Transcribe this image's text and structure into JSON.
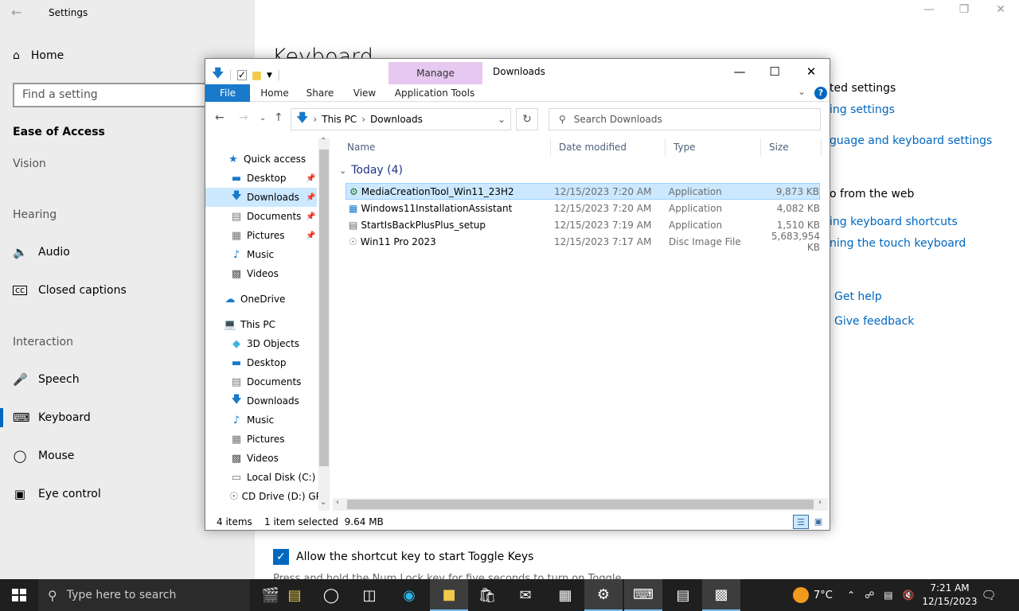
{
  "settings": {
    "title": "Settings",
    "home": "Home",
    "search_placeholder": "Find a setting",
    "category": "Ease of Access",
    "groups": {
      "vision": "Vision",
      "hearing": "Hearing",
      "interaction": "Interaction"
    },
    "items": {
      "audio": "Audio",
      "closed_captions": "Closed captions",
      "speech": "Speech",
      "keyboard": "Keyboard",
      "mouse": "Mouse",
      "eye_control": "Eye control"
    },
    "heading": "Keyboard",
    "right_panel": {
      "related_title": "ted settings",
      "link1": "ing settings",
      "link2": "guage and keyboard settings",
      "web_title": "o from the web",
      "link3": "ing keyboard shortcuts",
      "link4": "ning the touch keyboard",
      "get_help": "Get help",
      "give_feedback": "Give feedback"
    },
    "toggle_checkbox_label": "Allow the shortcut key to start Toggle Keys",
    "toggle_desc": "Press and hold the Num Lock key for five seconds to turn on Toggle"
  },
  "explorer": {
    "window_title": "Downloads",
    "manage_tab": "Manage",
    "ribbon_tabs": [
      "File",
      "Home",
      "Share",
      "View",
      "Application Tools"
    ],
    "address": {
      "segments": [
        "This PC",
        "Downloads"
      ]
    },
    "search_placeholder": "Search Downloads",
    "nav": {
      "quick_access": "Quick access",
      "desktop": "Desktop",
      "downloads": "Downloads",
      "documents": "Documents",
      "pictures": "Pictures",
      "music": "Music",
      "videos": "Videos",
      "onedrive": "OneDrive",
      "this_pc": "This PC",
      "objects3d": "3D Objects",
      "pc_desktop": "Desktop",
      "pc_documents": "Documents",
      "pc_downloads": "Downloads",
      "pc_music": "Music",
      "pc_pictures": "Pictures",
      "pc_videos": "Videos",
      "local_disk": "Local Disk (C:)",
      "cd_drive": "CD Drive (D:) GP"
    },
    "columns": {
      "name": "Name",
      "date": "Date modified",
      "type": "Type",
      "size": "Size"
    },
    "group_label": "Today (4)",
    "files": [
      {
        "name": "MediaCreationTool_Win11_23H2",
        "date": "12/15/2023 7:20 AM",
        "type": "Application",
        "size": "9,873 KB"
      },
      {
        "name": "Windows11InstallationAssistant",
        "date": "12/15/2023 7:20 AM",
        "type": "Application",
        "size": "4,082 KB"
      },
      {
        "name": "StartIsBackPlusPlus_setup",
        "date": "12/15/2023 7:19 AM",
        "type": "Application",
        "size": "1,510 KB"
      },
      {
        "name": "Win11 Pro 2023",
        "date": "12/15/2023 7:17 AM",
        "type": "Disc Image File",
        "size": "5,683,954 KB"
      }
    ],
    "status": {
      "count": "4 items",
      "selected": "1 item selected  9.64 MB"
    }
  },
  "taskbar": {
    "search_placeholder": "Type here to search",
    "weather": "7°C",
    "time": "7:21 AM",
    "date": "12/15/2023"
  },
  "colors": {
    "accent": "#0067c0",
    "selection": "#cce8ff",
    "manage_tab": "#e6c8f0",
    "taskbar": "#1f1f1f"
  }
}
